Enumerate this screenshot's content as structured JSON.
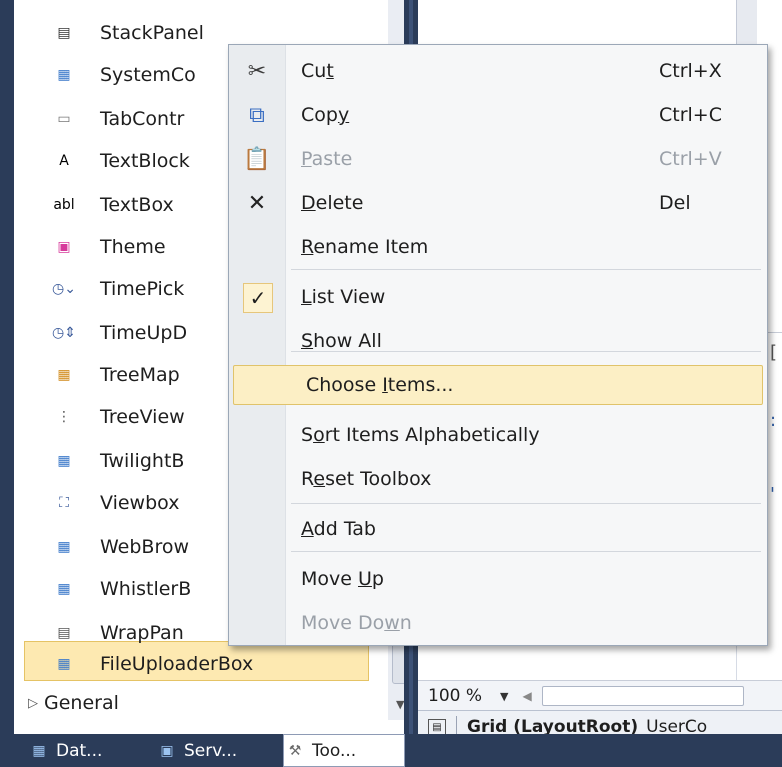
{
  "toolbox": {
    "items": [
      {
        "label": "StackPanel",
        "icon": "stackpanel-icon",
        "glyph": "▤"
      },
      {
        "label": "SystemCo",
        "icon": "control-icon",
        "glyph": "▦"
      },
      {
        "label": "TabContr",
        "icon": "tabcontrol-icon",
        "glyph": "▭"
      },
      {
        "label": "TextBlock",
        "icon": "textblock-icon",
        "glyph": "A"
      },
      {
        "label": "TextBox",
        "icon": "textbox-icon",
        "glyph": "abl"
      },
      {
        "label": "Theme",
        "icon": "theme-icon",
        "glyph": "▣"
      },
      {
        "label": "TimePick",
        "icon": "timepicker-icon",
        "glyph": "◷⌄"
      },
      {
        "label": "TimeUpD",
        "icon": "timeupdown-icon",
        "glyph": "◷⇕"
      },
      {
        "label": "TreeMap",
        "icon": "treemap-icon",
        "glyph": "▦"
      },
      {
        "label": "TreeView",
        "icon": "treeview-icon",
        "glyph": "⋮"
      },
      {
        "label": "TwilightB",
        "icon": "control-icon",
        "glyph": "▦"
      },
      {
        "label": "Viewbox",
        "icon": "viewbox-icon",
        "glyph": "⛶"
      },
      {
        "label": "WebBrow",
        "icon": "control-icon",
        "glyph": "▦"
      },
      {
        "label": "WhistlerB",
        "icon": "control-icon",
        "glyph": "▦"
      },
      {
        "label": "WrapPan",
        "icon": "wrappanel-icon",
        "glyph": "▤"
      },
      {
        "label": "FileUploaderBox",
        "icon": "control-icon",
        "glyph": "▦"
      }
    ],
    "group": "General"
  },
  "bottom_tabs": [
    {
      "label": "Dat...",
      "icon": "datasources-icon"
    },
    {
      "label": "Serv...",
      "icon": "server-explorer-icon"
    },
    {
      "label": "Too...",
      "icon": "toolbox-icon"
    }
  ],
  "context_menu": {
    "items": [
      {
        "label": "Cut",
        "underline": "t",
        "pre": "Cu",
        "post": "",
        "shortcut": "Ctrl+X",
        "icon": "scissors-icon"
      },
      {
        "label": "Copy",
        "pre": "Cop",
        "underline": "y",
        "post": "",
        "shortcut": "Ctrl+C",
        "icon": "copy-icon"
      },
      {
        "label": "Paste",
        "pre": "",
        "underline": "P",
        "post": "aste",
        "shortcut": "Ctrl+V",
        "icon": "paste-icon"
      },
      {
        "label": "Delete",
        "pre": "",
        "underline": "D",
        "post": "elete",
        "shortcut": "Del",
        "icon": "delete-icon"
      },
      {
        "label": "Rename Item",
        "pre": "",
        "underline": "R",
        "post": "ename Item",
        "shortcut": ""
      },
      {
        "label": "List View",
        "pre": "",
        "underline": "L",
        "post": "ist View",
        "shortcut": ""
      },
      {
        "label": "Show All",
        "pre": "",
        "underline": "S",
        "post": "how All",
        "shortcut": ""
      },
      {
        "label": "Choose Items...",
        "pre": "Choose ",
        "underline": "I",
        "post": "tems...",
        "shortcut": ""
      },
      {
        "label": "Sort Items Alphabetically",
        "pre": "S",
        "underline": "o",
        "post": "rt Items Alphabetically",
        "shortcut": ""
      },
      {
        "label": "Reset Toolbox",
        "pre": "R",
        "underline": "e",
        "post": "set Toolbox",
        "shortcut": ""
      },
      {
        "label": "Add Tab",
        "pre": "",
        "underline": "A",
        "post": "dd Tab",
        "shortcut": ""
      },
      {
        "label": "Move Up",
        "pre": "Move ",
        "underline": "U",
        "post": "p",
        "shortcut": ""
      },
      {
        "label": "Move Down",
        "pre": "Move Do",
        "underline": "w",
        "post": "n",
        "shortcut": ""
      }
    ]
  },
  "designer": {
    "zoom": "100 %",
    "status_bold": "Grid (LayoutRoot)",
    "status_rest": "UserCo"
  }
}
